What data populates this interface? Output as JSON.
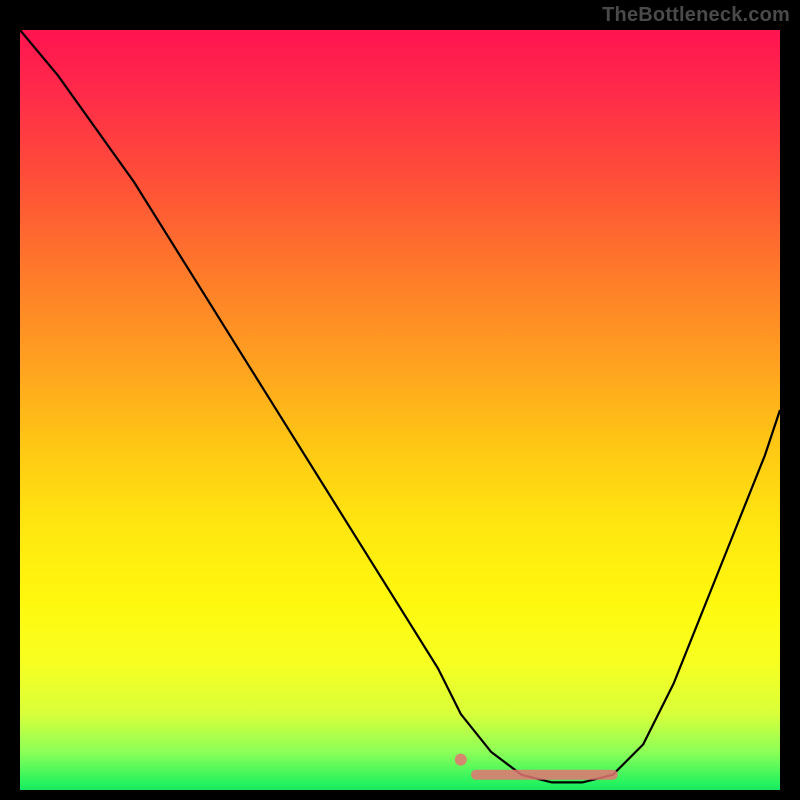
{
  "watermark": "TheBottleneck.com",
  "colors": {
    "page_bg": "#000000",
    "curve": "#000000",
    "marker": "#e57373",
    "gradient_top": "#ff1450",
    "gradient_bottom": "#18e860"
  },
  "chart_data": {
    "type": "line",
    "title": "",
    "xlabel": "",
    "ylabel": "",
    "xlim": [
      0,
      100
    ],
    "ylim": [
      0,
      100
    ],
    "grid": false,
    "legend": false,
    "series": [
      {
        "name": "bottleneck-curve",
        "x": [
          0,
          5,
          10,
          15,
          20,
          25,
          30,
          35,
          40,
          45,
          50,
          55,
          58,
          62,
          66,
          70,
          74,
          78,
          82,
          86,
          90,
          94,
          98,
          100
        ],
        "y": [
          100,
          94,
          87,
          80,
          72,
          64,
          56,
          48,
          40,
          32,
          24,
          16,
          10,
          5,
          2,
          1,
          1,
          2,
          6,
          14,
          24,
          34,
          44,
          50
        ]
      }
    ],
    "optimal_range": {
      "x_start": 60,
      "x_end": 78,
      "y": 2
    },
    "optimal_marker_dot": {
      "x": 58,
      "y": 4
    }
  }
}
